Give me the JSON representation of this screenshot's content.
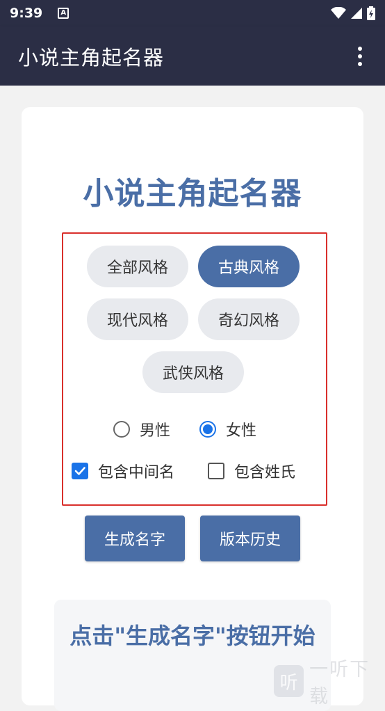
{
  "status_bar": {
    "time": "9:39",
    "notification_icon": "a-icon",
    "icons": [
      "wifi-icon",
      "signal-icon",
      "battery-icon"
    ]
  },
  "app_bar": {
    "title": "小说主角起名器",
    "menu_icon": "more-vert-icon"
  },
  "card": {
    "title": "小说主角起名器",
    "styles": [
      {
        "label": "全部风格",
        "selected": false
      },
      {
        "label": "古典风格",
        "selected": true
      },
      {
        "label": "现代风格",
        "selected": false
      },
      {
        "label": "奇幻风格",
        "selected": false
      },
      {
        "label": "武侠风格",
        "selected": false
      }
    ],
    "gender": {
      "options": [
        {
          "label": "男性",
          "checked": false
        },
        {
          "label": "女性",
          "checked": true
        }
      ]
    },
    "checkboxes": [
      {
        "label": "包含中间名",
        "checked": true
      },
      {
        "label": "包含姓氏",
        "checked": false
      }
    ],
    "buttons": {
      "generate": "生成名字",
      "history": "版本历史"
    },
    "result_text": "点击\"生成名字\"按钮开始"
  },
  "watermark": {
    "glyph": "听",
    "text": "一听下载"
  },
  "colors": {
    "app_bar": "#2b2e45",
    "accent": "#4a6ea6",
    "radio_check": "#1a73e8",
    "highlight_box": "#d9302c"
  }
}
